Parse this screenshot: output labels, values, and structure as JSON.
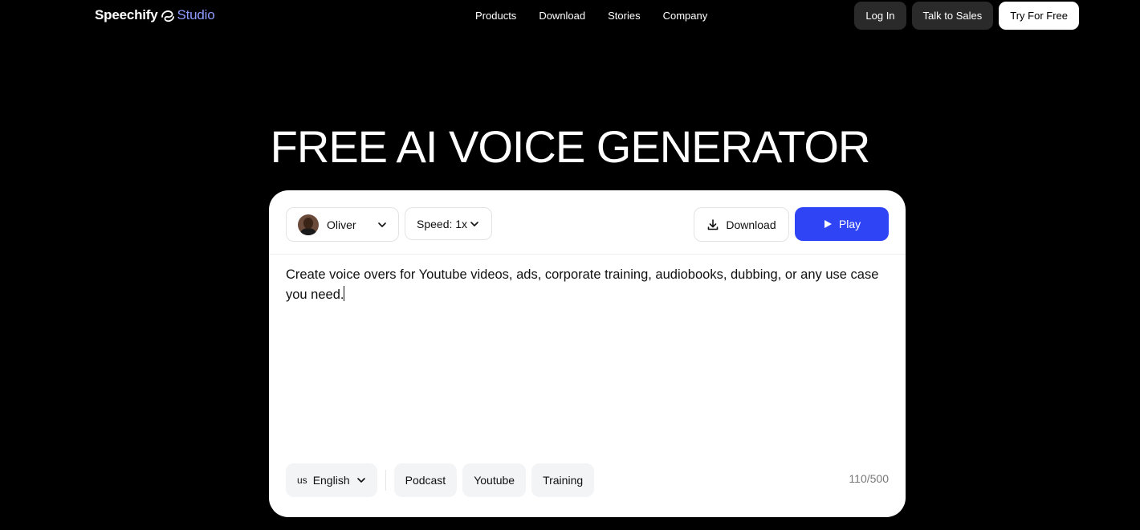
{
  "header": {
    "logo_brand": "Speechify",
    "logo_studio": "Studio",
    "nav": [
      "Products",
      "Download",
      "Stories",
      "Company"
    ],
    "login_label": "Log In",
    "sales_label": "Talk to Sales",
    "try_label": "Try For Free"
  },
  "hero": {
    "title": "FREE AI VOICE GENERATOR"
  },
  "editor": {
    "voice_name": "Oliver",
    "speed_label": "Speed: 1x",
    "download_label": "Download",
    "play_label": "Play",
    "text": "Create voice overs for Youtube videos, ads, corporate training, audiobooks, dubbing, or any use case you need.",
    "language_flag": "us",
    "language_label": "English",
    "presets": [
      "Podcast",
      "Youtube",
      "Training"
    ],
    "char_count": "110/500"
  },
  "colors": {
    "background": "#000000",
    "accent": "#2f45f5",
    "studio_text": "#8f9bff"
  }
}
